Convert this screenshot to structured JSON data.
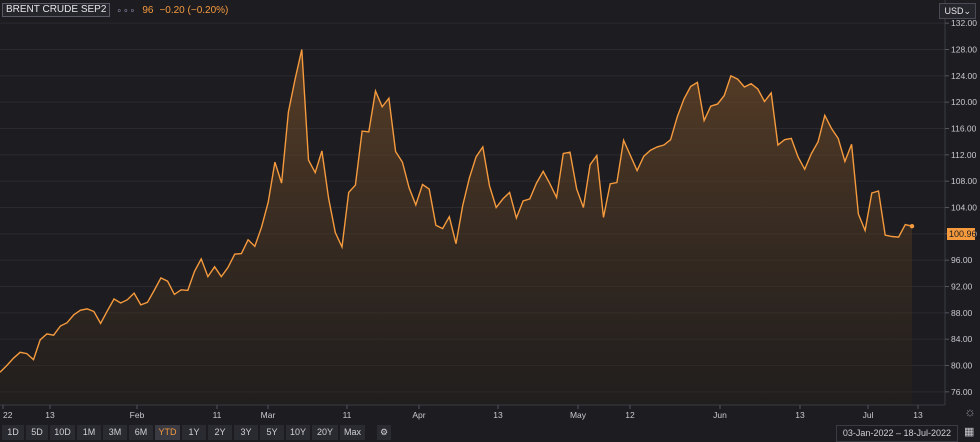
{
  "header": {
    "instrument": "BRENT CRUDE SEP2",
    "dots": "∘∘∘",
    "last_price": "96",
    "change": "−0.20 (−0.20%)",
    "currency": "USD⌄"
  },
  "price_tag": "100.96",
  "range_buttons": [
    "1D",
    "5D",
    "10D",
    "1M",
    "3M",
    "6M",
    "YTD",
    "1Y",
    "2Y",
    "3Y",
    "5Y",
    "10Y",
    "20Y",
    "Max"
  ],
  "active_range": "YTD",
  "date_range": "03-Jan-2022 – 18-Jul-2022",
  "colors": {
    "line": "#f59a3d",
    "background": "#1c1c21"
  },
  "chart_data": {
    "type": "area",
    "title": "",
    "xlabel": "",
    "ylabel": "",
    "ylim": [
      74,
      134
    ],
    "y_ticks": [
      76,
      80,
      84,
      88,
      92,
      96,
      100,
      104,
      108,
      112,
      116,
      120,
      124,
      128,
      132
    ],
    "x_ticks": [
      "22",
      "13",
      "Feb",
      "11",
      "Mar",
      "11",
      "Apr",
      "13",
      "May",
      "12",
      "Jun",
      "13",
      "Jul",
      "13"
    ],
    "values": [
      78.98,
      79.99,
      81.1,
      82.0,
      81.8,
      80.9,
      83.9,
      84.8,
      84.6,
      86.0,
      86.5,
      87.7,
      88.4,
      88.6,
      88.2,
      86.4,
      88.3,
      90.1,
      89.5,
      90.0,
      91.0,
      89.2,
      89.6,
      91.4,
      93.3,
      92.8,
      90.8,
      91.5,
      91.4,
      94.3,
      96.2,
      93.5,
      95.0,
      93.5,
      94.9,
      96.9,
      97.0,
      99.1,
      98.1,
      101.0,
      104.8,
      110.9,
      107.7,
      118.5,
      123.5,
      128.0,
      111.2,
      109.3,
      112.6,
      105.4,
      100.2,
      98.0,
      106.3,
      107.4,
      115.6,
      115.5,
      121.7,
      119.3,
      120.6,
      112.5,
      110.9,
      107.0,
      104.4,
      107.5,
      106.8,
      101.3,
      100.8,
      102.6,
      98.5,
      104.3,
      108.5,
      111.7,
      113.2,
      107.3,
      104.0,
      105.3,
      106.3,
      102.4,
      105.0,
      105.3,
      107.7,
      109.5,
      107.6,
      105.5,
      112.2,
      112.4,
      106.8,
      104.0,
      110.5,
      111.9,
      102.5,
      107.6,
      107.8,
      114.2,
      111.9,
      109.6,
      111.8,
      112.7,
      113.2,
      113.5,
      114.3,
      117.8,
      120.5,
      122.4,
      123.0,
      117.2,
      119.4,
      119.7,
      121.0,
      124.0,
      123.5,
      122.3,
      122.8,
      122.0,
      120.1,
      121.4,
      113.5,
      114.3,
      114.5,
      111.7,
      109.8,
      112.2,
      114.0,
      118.0,
      116.0,
      114.5,
      111.0,
      113.6,
      103.0,
      100.5,
      106.2,
      106.5,
      99.8,
      99.6,
      99.5,
      101.4,
      101.16
    ]
  }
}
